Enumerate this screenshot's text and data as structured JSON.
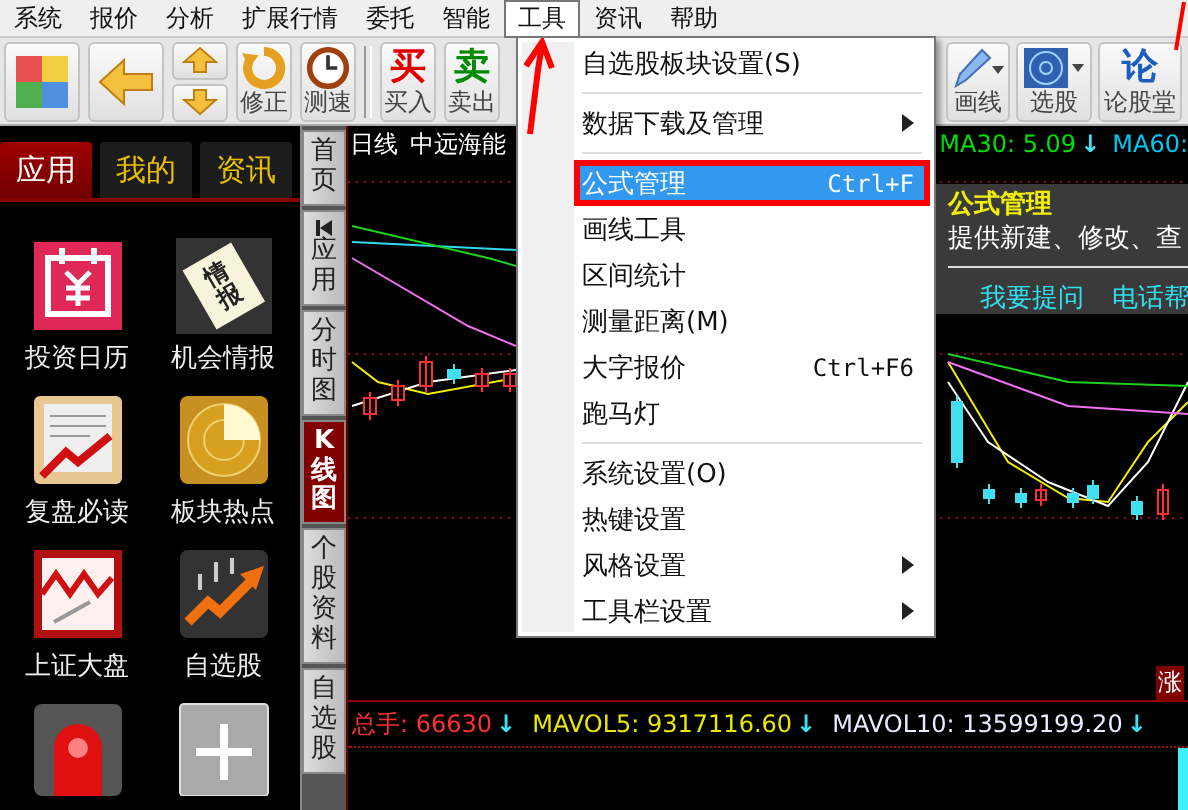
{
  "menubar": [
    {
      "label": "系统",
      "selected": false
    },
    {
      "label": "报价",
      "selected": false
    },
    {
      "label": "分析",
      "selected": false
    },
    {
      "label": "扩展行情",
      "selected": false
    },
    {
      "label": "委托",
      "selected": false
    },
    {
      "label": "智能",
      "selected": false
    },
    {
      "label": "工具",
      "selected": true
    },
    {
      "label": "资讯",
      "selected": false
    },
    {
      "label": "帮助",
      "selected": false
    }
  ],
  "toolbar": {
    "groups": [
      [
        {
          "kind": "grid"
        },
        {
          "kind": "back"
        },
        {
          "kind": "updown"
        },
        {
          "kind": "refresh",
          "label": "修正"
        },
        {
          "kind": "clock",
          "label": "测速"
        }
      ],
      [
        {
          "kind": "glyph",
          "glyph": "买",
          "color": "#e00000",
          "label": "买入"
        },
        {
          "kind": "glyph",
          "glyph": "卖",
          "color": "#008a00",
          "label": "卖出"
        }
      ],
      [
        {
          "kind": "pencil",
          "label": "画线"
        },
        {
          "kind": "radar",
          "label": "选股"
        },
        {
          "kind": "glyph",
          "glyph": "论",
          "color": "#1a5fc0",
          "label": "论股堂"
        }
      ]
    ]
  },
  "side_panel": {
    "tabs": [
      {
        "label": "应用",
        "selected": true
      },
      {
        "label": "我的",
        "selected": false
      },
      {
        "label": "资讯",
        "selected": false
      }
    ],
    "apps": [
      {
        "kind": "calendar",
        "label": "投资日历"
      },
      {
        "kind": "card",
        "glyph": "情报",
        "label": "机会情报"
      },
      {
        "kind": "newspaper",
        "label": "复盘必读"
      },
      {
        "kind": "radar",
        "label": "板块热点"
      },
      {
        "kind": "zigzag",
        "label": "上证大盘"
      },
      {
        "kind": "rising",
        "label": "自选股"
      },
      {
        "kind": "siren"
      },
      {
        "kind": "add"
      }
    ]
  },
  "vertical_tabs": [
    {
      "label": "首页",
      "selected": false
    },
    {
      "label": "应用",
      "selected": false,
      "kind": "collapse"
    },
    {
      "label": "分时图",
      "selected": false
    },
    {
      "label": "K线图",
      "selected": true
    },
    {
      "label": "个股资料",
      "selected": false
    },
    {
      "label": "自选股",
      "selected": false
    }
  ],
  "chart": {
    "header": [
      "日线",
      "中远海能"
    ],
    "ma": [
      {
        "text": "MA30: 5.09",
        "color": "#00e000",
        "arrow": "↓"
      },
      {
        "text": "MA60:",
        "color": "#00c8f0"
      }
    ],
    "badge": "涨",
    "volume": [
      {
        "text": "总手: 66630",
        "color": "#ff3030",
        "arrow": "↓"
      },
      {
        "text": "MAVOL5: 9317116.60",
        "color": "#e8e800",
        "arrow": "↓"
      },
      {
        "text": "MAVOL10: 13599199.20",
        "color": "#e8ecff",
        "arrow": "↓"
      }
    ]
  },
  "menu": {
    "groups": [
      [
        {
          "label": "自选股板块设置(S)",
          "selected": false,
          "submenu": false
        }
      ],
      [
        {
          "label": "数据下载及管理",
          "selected": false,
          "submenu": true
        }
      ],
      [
        {
          "label": "公式管理",
          "shortcut": "Ctrl+F",
          "selected": true,
          "submenu": false
        },
        {
          "label": "画线工具",
          "selected": false,
          "submenu": false
        },
        {
          "label": "区间统计",
          "selected": false,
          "submenu": false
        },
        {
          "label": "测量距离(M)",
          "selected": false,
          "submenu": false
        },
        {
          "label": "大字报价",
          "shortcut": "Ctrl+F6",
          "selected": false,
          "submenu": false
        },
        {
          "label": "跑马灯",
          "selected": false,
          "submenu": false
        }
      ],
      [
        {
          "label": "系统设置(O)",
          "selected": false,
          "submenu": false
        },
        {
          "label": "热键设置",
          "selected": false,
          "submenu": false
        },
        {
          "label": "风格设置",
          "selected": false,
          "submenu": true
        },
        {
          "label": "工具栏设置",
          "selected": false,
          "submenu": true
        }
      ]
    ]
  },
  "tooltip": {
    "title": "公式管理",
    "text": "提供新建、修改、查",
    "links": [
      "我要提问",
      "电话帮"
    ]
  }
}
